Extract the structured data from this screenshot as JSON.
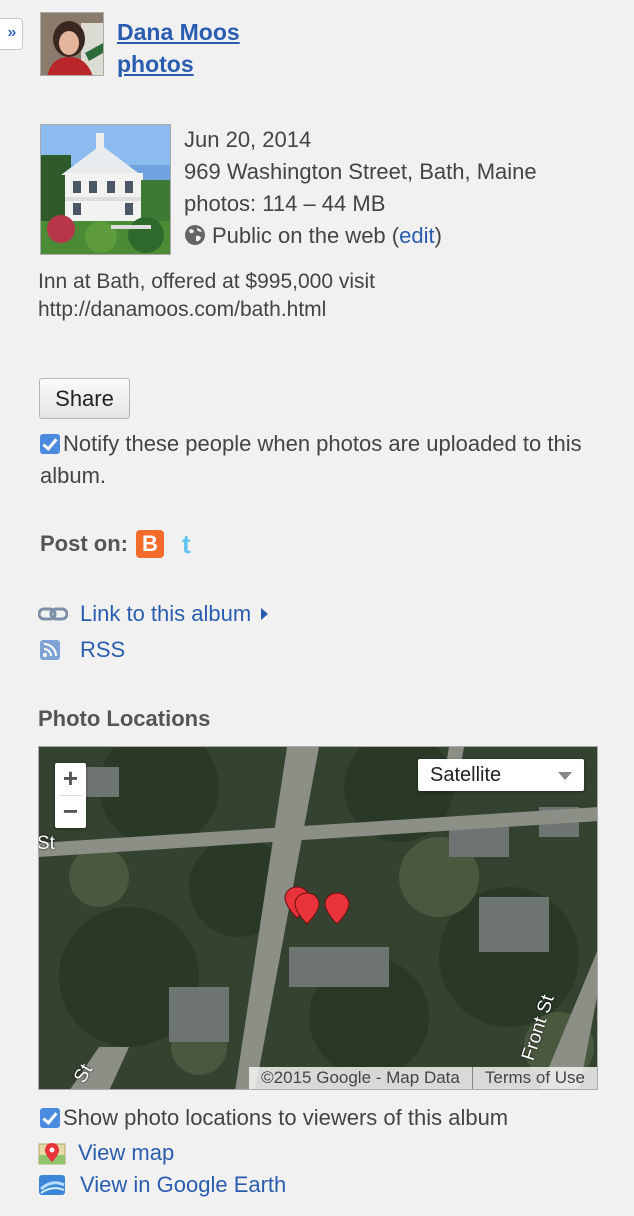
{
  "panel": {
    "collapse_icon": "double-chevron-right-icon",
    "collapse_glyph": "»"
  },
  "owner": {
    "name": "Dana Moos",
    "photos_label": "photos"
  },
  "album": {
    "date": "Jun 20, 2014",
    "location": "969 Washington Street, Bath, Maine",
    "stats": "photos: 114 – 44 MB",
    "visibility": "Public on the web",
    "edit_open": "(",
    "edit_label": "edit",
    "edit_close": ")",
    "description": "Inn at Bath, offered at $995,000 visit http://danamoos.com/bath.html"
  },
  "share": {
    "button_label": "Share",
    "notify_label": "Notify these people when photos are uploaded to this album.",
    "notify_checked": true
  },
  "post_on": {
    "label": "Post on:",
    "services": [
      "blogger-icon",
      "twitter-icon"
    ],
    "blogger_glyph": "B",
    "twitter_glyph": "t"
  },
  "links": {
    "album_link": "Link to this album",
    "rss": "RSS"
  },
  "locations": {
    "title": "Photo Locations",
    "map_type": "Satellite",
    "zoom_in": "+",
    "zoom_out": "−",
    "attribution": "©2015 Google - Map Data",
    "terms": "Terms of Use",
    "street_labels": [
      "St",
      "St",
      "Front St"
    ],
    "show_label": "Show photo locations to viewers of this album",
    "show_checked": true,
    "view_map": "View map",
    "view_earth": "View in Google Earth"
  },
  "colors": {
    "link": "#2a5db0",
    "checkbox": "#4a8be0",
    "blogger": "#f26b2a",
    "twitter": "#5fc3ee",
    "marker": "#e8333a"
  }
}
